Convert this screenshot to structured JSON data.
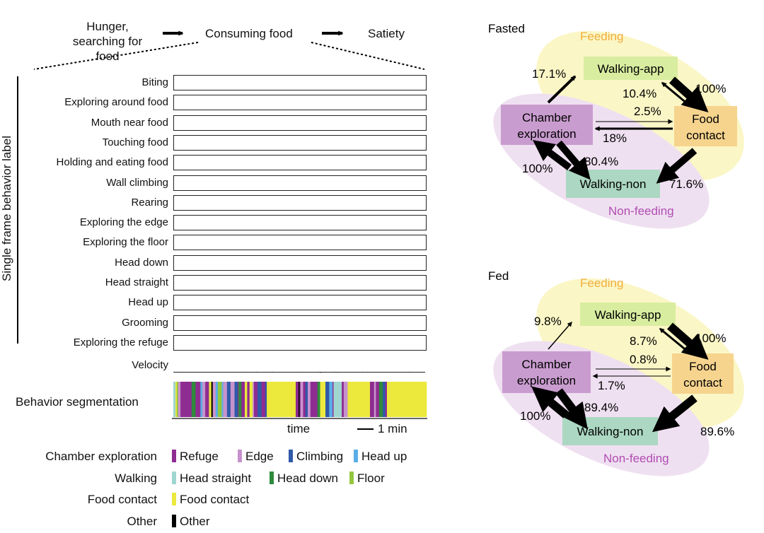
{
  "flow": {
    "step1_line1": "Hunger,",
    "step1_line2": "searching for food",
    "step2": "Consuming food",
    "step3": "Satiety"
  },
  "ethogram": {
    "ylabel": "Single frame behavior label",
    "rows": [
      "Biting",
      "Exploring around food",
      "Mouth near food",
      "Touching food",
      "Holding and eating food",
      "Wall climbing",
      "Rearing",
      "Exploring the edge",
      "Exploring the floor",
      "Head down",
      "Head straight",
      "Head up",
      "Grooming",
      "Exploring the refuge"
    ],
    "velocity_label": "Velocity",
    "raster_color": "#1f2a6b"
  },
  "segmentation": {
    "label": "Behavior segmentation",
    "xlabel": "time",
    "scale": "1 min"
  },
  "legend": [
    {
      "group": "Chamber exploration",
      "items": [
        {
          "label": "Refuge",
          "color": "#8e2c91"
        },
        {
          "label": "Edge",
          "color": "#c792cc"
        },
        {
          "label": "Climbing",
          "color": "#2f5aa8"
        },
        {
          "label": "Head up",
          "color": "#5aaee6"
        }
      ]
    },
    {
      "group": "Walking",
      "items": [
        {
          "label": "Head straight",
          "color": "#9fd6d0"
        },
        {
          "label": "Head down",
          "color": "#2e8a3c"
        },
        {
          "label": "Floor",
          "color": "#94c63e"
        }
      ]
    },
    {
      "group": "Food contact",
      "items": [
        {
          "label": "Food contact",
          "color": "#ece83c"
        }
      ]
    },
    {
      "group": "Other",
      "items": [
        {
          "label": "Other",
          "color": "#000000"
        }
      ]
    }
  ],
  "diagrams": [
    {
      "title": "Fasted",
      "feeding": "Feeding",
      "nonfeeding": "Non-feeding",
      "nodes": {
        "walk_app": "Walking-app",
        "chamber_1": "Chamber",
        "chamber_2": "exploration",
        "food_1": "Food",
        "food_2": "contact",
        "walk_non": "Walking-non"
      },
      "edges": [
        {
          "from": "Chamber exploration",
          "to": "Walking-app",
          "value": "17.1%"
        },
        {
          "from": "Walking-app",
          "to": "Food contact",
          "value": "100%"
        },
        {
          "from": "Food contact",
          "to": "Walking-app",
          "value": "10.4%"
        },
        {
          "from": "Chamber exploration",
          "to": "Food contact",
          "value": "2.5%"
        },
        {
          "from": "Food contact",
          "to": "Chamber exploration",
          "value": "18%"
        },
        {
          "from": "Chamber exploration",
          "to": "Walking-non",
          "value": "80.4%"
        },
        {
          "from": "Walking-non",
          "to": "Chamber exploration",
          "value": "100%"
        },
        {
          "from": "Food contact",
          "to": "Walking-non",
          "value": "71.6%"
        }
      ]
    },
    {
      "title": "Fed",
      "feeding": "Feeding",
      "nonfeeding": "Non-feeding",
      "nodes": {
        "walk_app": "Walking-app",
        "chamber_1": "Chamber",
        "chamber_2": "exploration",
        "food_1": "Food",
        "food_2": "contact",
        "walk_non": "Walking-non"
      },
      "edges": [
        {
          "from": "Chamber exploration",
          "to": "Walking-app",
          "value": "9.8%"
        },
        {
          "from": "Walking-app",
          "to": "Food contact",
          "value": "100%"
        },
        {
          "from": "Food contact",
          "to": "Walking-app",
          "value": "8.7%"
        },
        {
          "from": "Chamber exploration",
          "to": "Food contact",
          "value": "0.8%"
        },
        {
          "from": "Food contact",
          "to": "Chamber exploration",
          "value": "1.7%"
        },
        {
          "from": "Chamber exploration",
          "to": "Walking-non",
          "value": "89.4%"
        },
        {
          "from": "Walking-non",
          "to": "Chamber exploration",
          "value": "100%"
        },
        {
          "from": "Food contact",
          "to": "Walking-non",
          "value": "89.6%"
        }
      ]
    }
  ],
  "colors": {
    "feeding_bg": "#fbf6c6",
    "nonfeeding_bg": "#efe0f1",
    "feeding_text": "#f0ae3c",
    "nonfeeding_text": "#b04db2",
    "walk_app": "#d8eda0",
    "chamber": "#c99ccf",
    "food": "#f6d48e",
    "walk_non": "#acd7c2"
  }
}
